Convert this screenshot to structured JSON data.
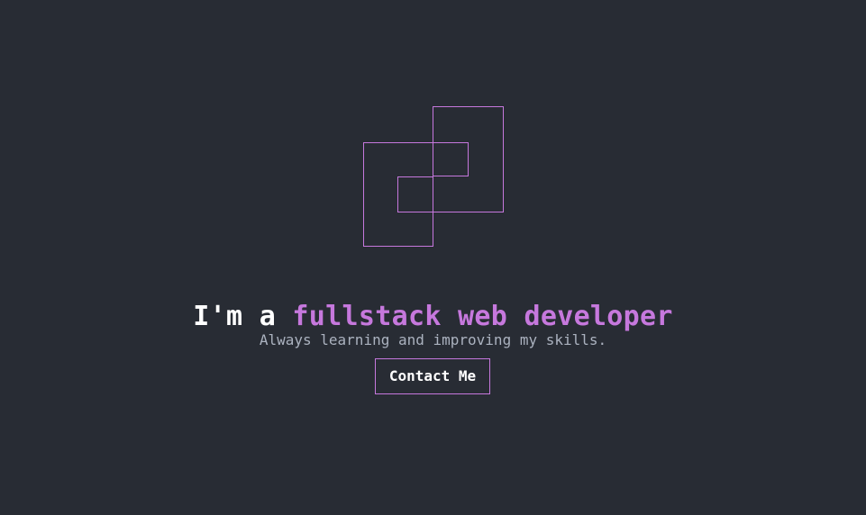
{
  "colors": {
    "background": "#282c34",
    "accent": "#c678dd",
    "text_primary": "#ffffff",
    "text_muted": "#abb2bf"
  },
  "hero": {
    "logo_icon": "interlocking-squares-logo-icon",
    "headline_prefix": "I'm a ",
    "headline_highlight": "fullstack web developer",
    "tagline": "Always learning and improving my skills.",
    "cta_label": "Contact Me"
  }
}
